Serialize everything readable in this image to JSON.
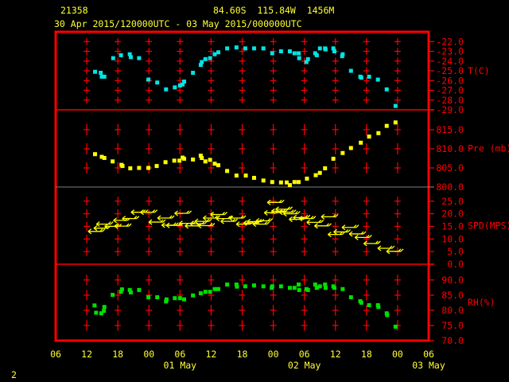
{
  "header": {
    "station": "21358",
    "location": "84.60S  115.84W  1456M",
    "period": "30 Apr 2015/120000UTC - 03 May 2015/000000UTC"
  },
  "footer": {
    "page_number": "2"
  },
  "colors": {
    "frame": "#ff0000",
    "text": "#ffff33",
    "temperature": "#00e5e5",
    "pressure": "#ffff00",
    "wind": "#ffff00",
    "rh": "#00e000"
  },
  "chart_data": {
    "type": "scatter",
    "x_unit": "hours since 30 Apr 2015 06 UTC",
    "xlim": [
      0,
      72
    ],
    "x_ticks": [
      {
        "h": 0,
        "label": "06"
      },
      {
        "h": 6,
        "label": "12"
      },
      {
        "h": 12,
        "label": "18"
      },
      {
        "h": 18,
        "label": "00"
      },
      {
        "h": 24,
        "label": "06"
      },
      {
        "h": 30,
        "label": "12"
      },
      {
        "h": 36,
        "label": "18"
      },
      {
        "h": 42,
        "label": "00"
      },
      {
        "h": 48,
        "label": "06"
      },
      {
        "h": 54,
        "label": "12"
      },
      {
        "h": 60,
        "label": "18"
      },
      {
        "h": 66,
        "label": "00"
      },
      {
        "h": 72,
        "label": "06"
      }
    ],
    "date_labels": [
      {
        "h": 24,
        "label": "01 May"
      },
      {
        "h": 48,
        "label": "02 May"
      },
      {
        "h": 72,
        "label": "03 May"
      }
    ],
    "panels": [
      {
        "name": "temperature",
        "unit_label": "T(C)",
        "ylim": [
          -29,
          -21
        ],
        "ticks": [
          "-22.0",
          "-23.0",
          "-24.0",
          "-25.0",
          "-26.0",
          "-27.0",
          "-28.0",
          "-29.0"
        ],
        "tick_values": [
          -22,
          -23,
          -24,
          -25,
          -26,
          -27,
          -28,
          -29
        ],
        "grid_values": [
          -22,
          -23,
          -24,
          -25,
          -26,
          -27,
          -28
        ],
        "points": [
          [
            7.6,
            -25.1
          ],
          [
            8.7,
            -25.2
          ],
          [
            8.9,
            -25.6
          ],
          [
            9.4,
            -25.6
          ],
          [
            11.1,
            -23.7
          ],
          [
            12.6,
            -23.4
          ],
          [
            14.3,
            -23.3
          ],
          [
            14.5,
            -23.6
          ],
          [
            16.1,
            -23.7
          ],
          [
            17.9,
            -25.9
          ],
          [
            19.6,
            -26.2
          ],
          [
            21.3,
            -26.9
          ],
          [
            23.0,
            -26.7
          ],
          [
            24.0,
            -26.5
          ],
          [
            24.5,
            -26.4
          ],
          [
            24.8,
            -26.1
          ],
          [
            26.5,
            -25.2
          ],
          [
            28.0,
            -24.4
          ],
          [
            28.2,
            -24.1
          ],
          [
            28.9,
            -23.8
          ],
          [
            29.8,
            -23.7
          ],
          [
            30.7,
            -23.3
          ],
          [
            31.4,
            -23.1
          ],
          [
            33.1,
            -22.7
          ],
          [
            34.9,
            -22.6
          ],
          [
            36.6,
            -22.7
          ],
          [
            38.3,
            -22.7
          ],
          [
            40.1,
            -22.7
          ],
          [
            41.8,
            -23.2
          ],
          [
            43.5,
            -23.0
          ],
          [
            45.2,
            -23.0
          ],
          [
            46.1,
            -23.2
          ],
          [
            46.9,
            -23.2
          ],
          [
            47.0,
            -23.7
          ],
          [
            48.4,
            -24.1
          ],
          [
            48.7,
            -23.8
          ],
          [
            50.1,
            -23.2
          ],
          [
            50.4,
            -23.4
          ],
          [
            51.0,
            -22.7
          ],
          [
            52.0,
            -22.7
          ],
          [
            52.1,
            -22.8
          ],
          [
            53.6,
            -22.7
          ],
          [
            53.8,
            -23.0
          ],
          [
            55.4,
            -23.3
          ],
          [
            55.3,
            -23.5
          ],
          [
            57.0,
            -25.0
          ],
          [
            58.8,
            -25.6
          ],
          [
            59.0,
            -25.7
          ],
          [
            60.5,
            -25.6
          ],
          [
            62.2,
            -25.9
          ],
          [
            63.9,
            -26.9
          ],
          [
            65.6,
            -28.6
          ]
        ]
      },
      {
        "name": "pressure",
        "unit_label": "Pre (mb)",
        "ylim": [
          800,
          820.2
        ],
        "ticks": [
          "815.0",
          "810.0",
          "805.0",
          "800.0"
        ],
        "tick_values": [
          815,
          810,
          805,
          800
        ],
        "grid_values": [
          815,
          810,
          805
        ],
        "points": [
          [
            7.6,
            808.6
          ],
          [
            8.9,
            807.9
          ],
          [
            9.4,
            807.6
          ],
          [
            11.0,
            806.7
          ],
          [
            12.7,
            805.8
          ],
          [
            12.9,
            805.5
          ],
          [
            14.4,
            804.9
          ],
          [
            16.1,
            805.0
          ],
          [
            17.9,
            805.0
          ],
          [
            19.5,
            805.5
          ],
          [
            21.2,
            806.5
          ],
          [
            22.9,
            806.9
          ],
          [
            23.9,
            806.9
          ],
          [
            24.5,
            807.7
          ],
          [
            24.8,
            807.4
          ],
          [
            26.5,
            807.2
          ],
          [
            28.0,
            808.2
          ],
          [
            28.2,
            807.6
          ],
          [
            28.9,
            806.7
          ],
          [
            29.8,
            807.1
          ],
          [
            30.7,
            806.1
          ],
          [
            31.4,
            805.7
          ],
          [
            33.1,
            804.2
          ],
          [
            34.9,
            803.0
          ],
          [
            36.7,
            803.0
          ],
          [
            38.3,
            802.4
          ],
          [
            40.1,
            801.7
          ],
          [
            41.8,
            801.3
          ],
          [
            43.5,
            801.2
          ],
          [
            44.6,
            801.2
          ],
          [
            45.2,
            800.5
          ],
          [
            46.1,
            801.3
          ],
          [
            46.9,
            801.3
          ],
          [
            48.5,
            802.2
          ],
          [
            50.2,
            803.1
          ],
          [
            51.0,
            803.7
          ],
          [
            52.0,
            804.9
          ],
          [
            53.6,
            807.4
          ],
          [
            55.4,
            808.9
          ],
          [
            57.0,
            810.2
          ],
          [
            58.9,
            811.6
          ],
          [
            60.5,
            813.2
          ],
          [
            62.3,
            814.1
          ],
          [
            63.9,
            816.0
          ],
          [
            65.6,
            816.9
          ]
        ]
      },
      {
        "name": "wind_speed",
        "unit_label": "SPD(MPS)",
        "ylim": [
          0,
          30.6
        ],
        "ticks": [
          "25.0",
          "20.0",
          "15.0",
          "10.0",
          "5.0",
          "0.0"
        ],
        "tick_values": [
          25,
          20,
          15,
          10,
          5,
          0
        ],
        "grid_values": [
          25,
          20,
          15,
          10,
          5
        ],
        "points": [
          [
            7.8,
            13.0
          ],
          [
            8.9,
            14.3
          ],
          [
            9.4,
            15.9
          ],
          [
            11.0,
            15.0
          ],
          [
            12.7,
            17.4
          ],
          [
            12.9,
            15.1
          ],
          [
            14.4,
            18.1
          ],
          [
            16.1,
            20.6
          ],
          [
            17.9,
            20.6
          ],
          [
            19.5,
            16.7
          ],
          [
            21.2,
            18.3
          ],
          [
            22.0,
            15.5
          ],
          [
            22.9,
            15.4
          ],
          [
            24.5,
            20.2
          ],
          [
            25.4,
            16.2
          ],
          [
            26.5,
            15.2
          ],
          [
            27.5,
            16.0
          ],
          [
            28.4,
            17.0
          ],
          [
            29.0,
            15.3
          ],
          [
            30.0,
            18.3
          ],
          [
            31.4,
            19.7
          ],
          [
            32.5,
            18.1
          ],
          [
            33.4,
            17.0
          ],
          [
            35.0,
            18.3
          ],
          [
            36.4,
            15.9
          ],
          [
            37.8,
            16.3
          ],
          [
            38.5,
            16.9
          ],
          [
            39.6,
            15.9
          ],
          [
            40.2,
            17.2
          ],
          [
            41.8,
            20.4
          ],
          [
            42.4,
            24.5
          ],
          [
            43.2,
            21.0
          ],
          [
            44.0,
            21.8
          ],
          [
            44.7,
            20.6
          ],
          [
            45.5,
            20.0
          ],
          [
            46.6,
            17.8
          ],
          [
            47.4,
            18.5
          ],
          [
            48.5,
            18.1
          ],
          [
            50.0,
            16.6
          ],
          [
            51.5,
            15.2
          ],
          [
            52.8,
            18.8
          ],
          [
            54.1,
            11.8
          ],
          [
            55.2,
            12.8
          ],
          [
            56.8,
            14.6
          ],
          [
            58.2,
            12.0
          ],
          [
            59.3,
            10.6
          ],
          [
            61.0,
            8.2
          ],
          [
            63.7,
            6.3
          ],
          [
            65.4,
            5.1
          ]
        ]
      },
      {
        "name": "relative_humidity",
        "unit_label": "RH(%)",
        "ylim": [
          70,
          95.2
        ],
        "ticks": [
          "90.0",
          "85.0",
          "80.0",
          "75.0",
          "70.0"
        ],
        "tick_values": [
          90,
          85,
          80,
          75,
          70
        ],
        "grid_values": [
          90,
          85,
          80,
          75
        ],
        "points": [
          [
            7.5,
            81.6
          ],
          [
            7.8,
            79.2
          ],
          [
            8.8,
            79.0
          ],
          [
            9.3,
            79.8
          ],
          [
            9.4,
            81.1
          ],
          [
            11.0,
            85.1
          ],
          [
            12.6,
            86.1
          ],
          [
            12.8,
            86.9
          ],
          [
            14.3,
            86.7
          ],
          [
            14.5,
            85.9
          ],
          [
            16.1,
            86.7
          ],
          [
            17.9,
            84.3
          ],
          [
            19.6,
            84.3
          ],
          [
            21.3,
            82.9
          ],
          [
            21.4,
            83.6
          ],
          [
            23.0,
            84.0
          ],
          [
            24.0,
            84.0
          ],
          [
            24.8,
            83.6
          ],
          [
            26.5,
            84.9
          ],
          [
            28.0,
            85.6
          ],
          [
            28.9,
            86.1
          ],
          [
            29.8,
            86.1
          ],
          [
            30.7,
            87.0
          ],
          [
            31.4,
            87.0
          ],
          [
            33.1,
            88.5
          ],
          [
            34.9,
            88.5
          ],
          [
            35.0,
            87.8
          ],
          [
            36.6,
            87.9
          ],
          [
            38.3,
            88.2
          ],
          [
            40.1,
            87.9
          ],
          [
            41.8,
            87.9
          ],
          [
            41.7,
            87.4
          ],
          [
            43.5,
            87.9
          ],
          [
            45.2,
            87.4
          ],
          [
            46.1,
            87.4
          ],
          [
            46.9,
            88.5
          ],
          [
            47.0,
            86.7
          ],
          [
            48.4,
            87.0
          ],
          [
            48.7,
            86.7
          ],
          [
            50.1,
            88.5
          ],
          [
            50.4,
            87.4
          ],
          [
            51.0,
            87.9
          ],
          [
            52.0,
            88.5
          ],
          [
            52.1,
            87.4
          ],
          [
            53.6,
            87.9
          ],
          [
            53.8,
            87.4
          ],
          [
            55.4,
            87.0
          ],
          [
            57.0,
            84.3
          ],
          [
            58.8,
            83.0
          ],
          [
            59.0,
            82.5
          ],
          [
            60.5,
            81.7
          ],
          [
            62.2,
            81.7
          ],
          [
            62.3,
            81.1
          ],
          [
            63.9,
            79.0
          ],
          [
            64.0,
            78.4
          ],
          [
            65.6,
            74.6
          ]
        ]
      }
    ]
  }
}
